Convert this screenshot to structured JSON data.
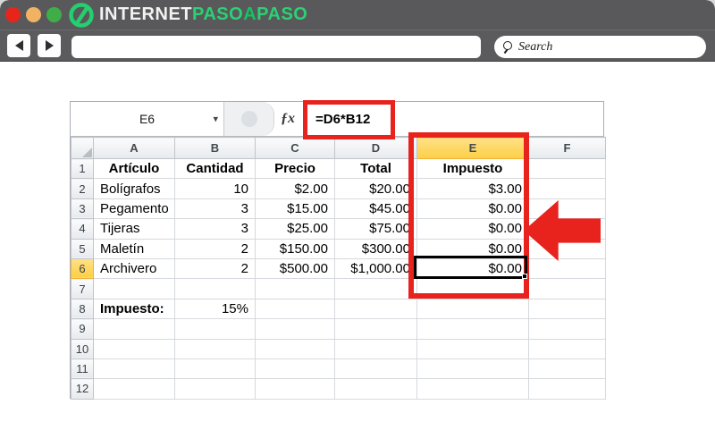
{
  "brand": {
    "part1": "INTERNET",
    "part2": "PASO",
    "part3": "A",
    "part4": "PASO"
  },
  "search": {
    "label": "Search"
  },
  "icons": {
    "back": "left-triangle",
    "forward": "right-triangle",
    "search": "magnifier",
    "name_box_caret": "▾",
    "select_all_corner": "gray-triangle"
  },
  "colors": {
    "accent_red": "#e8231e",
    "brand_green": "#2bd173",
    "chrome_gray": "#59595b",
    "selected_header_bg": "#fccf45"
  },
  "spreadsheet": {
    "name_box": "E6",
    "fx_label": "ƒx",
    "formula": "=D6*B12",
    "selected_cell": "E6",
    "selected_column": "E",
    "selected_row": 6,
    "columns": [
      "A",
      "B",
      "C",
      "D",
      "E",
      "F"
    ],
    "rows": [
      {
        "n": 1,
        "A": "Artículo",
        "B": "Cantidad",
        "C": "Precio",
        "D": "Total",
        "E": "Impuesto",
        "F": ""
      },
      {
        "n": 2,
        "A": "Bolígrafos",
        "B": "10",
        "C": "$2.00",
        "D": "$20.00",
        "E": "$3.00",
        "F": ""
      },
      {
        "n": 3,
        "A": "Pegamento",
        "B": "3",
        "C": "$15.00",
        "D": "$45.00",
        "E": "$0.00",
        "F": ""
      },
      {
        "n": 4,
        "A": "Tijeras",
        "B": "3",
        "C": "$25.00",
        "D": "$75.00",
        "E": "$0.00",
        "F": ""
      },
      {
        "n": 5,
        "A": "Maletín",
        "B": "2",
        "C": "$150.00",
        "D": "$300.00",
        "E": "$0.00",
        "F": ""
      },
      {
        "n": 6,
        "A": "Archivero",
        "B": "2",
        "C": "$500.00",
        "D": "$1,000.00",
        "E": "$0.00",
        "F": ""
      },
      {
        "n": 7
      },
      {
        "n": 8,
        "A": "Impuesto:",
        "B": "15%"
      },
      {
        "n": 9
      },
      {
        "n": 10
      },
      {
        "n": 11
      },
      {
        "n": 12
      }
    ]
  }
}
